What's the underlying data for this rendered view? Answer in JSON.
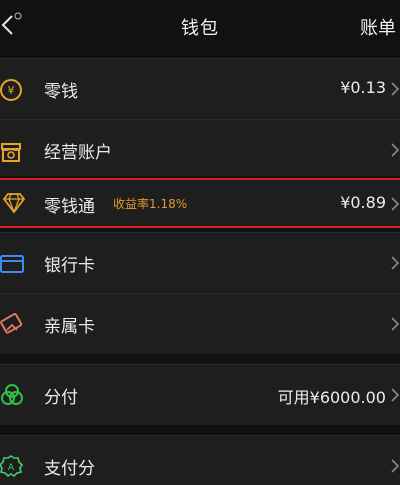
{
  "header": {
    "title": "钱包",
    "bill_label": "账单"
  },
  "items": [
    {
      "label": "零钱",
      "value": "¥0.13"
    },
    {
      "label": "经营账户",
      "value": ""
    },
    {
      "label": "零钱通",
      "badge": "收益率1.18%",
      "value": "¥0.89"
    },
    {
      "label": "银行卡",
      "value": ""
    },
    {
      "label": "亲属卡",
      "value": ""
    },
    {
      "label": "分付",
      "value": "可用¥6000.00"
    },
    {
      "label": "支付分",
      "value": ""
    }
  ],
  "colors": {
    "accent_orange": "#e39a2c",
    "highlight_red": "#d02020",
    "bank_card_blue": "#3b8df0",
    "fenfu_green": "#2fbf4a",
    "zhifufen_green": "#3fcf6a"
  }
}
